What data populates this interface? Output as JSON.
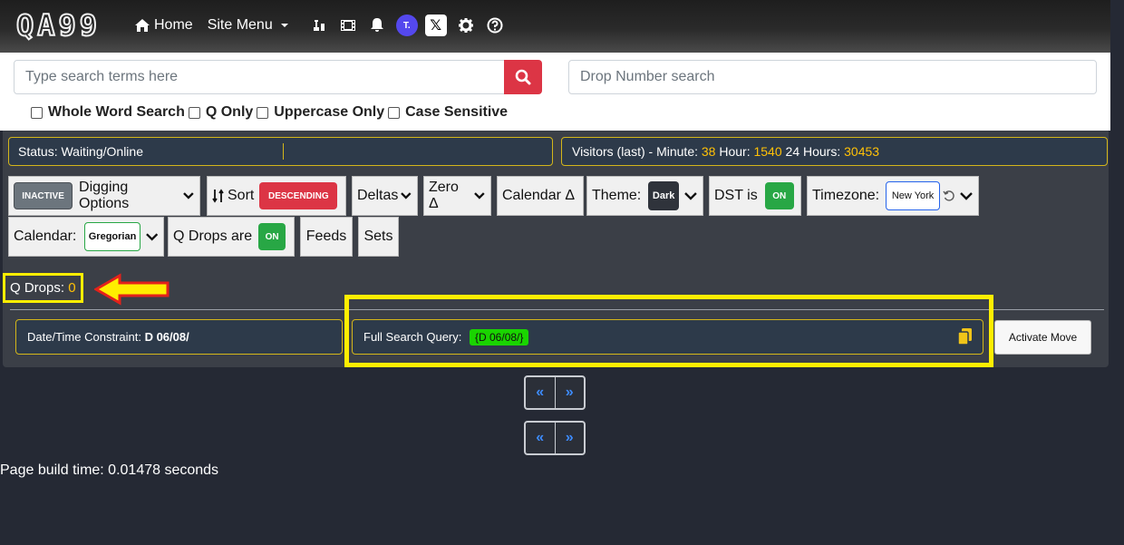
{
  "nav": {
    "logo_chars": [
      "Q",
      "A",
      "9",
      "9"
    ],
    "home_label": "Home",
    "site_menu_label": "Site Menu",
    "truth_label": "T."
  },
  "search": {
    "placeholder": "Type search terms here",
    "drop_placeholder": "Drop Number search",
    "options": [
      "Whole Word Search",
      "Q Only",
      "Uppercase Only",
      "Case Sensitive"
    ]
  },
  "status": {
    "text": "Status: Waiting/Online"
  },
  "visitors": {
    "prefix": "Visitors (last) - Minute: ",
    "minute": "38",
    "hour_label": " Hour: ",
    "hour": "1540",
    "day_label": " 24 Hours: ",
    "day": "30453"
  },
  "toolbar": {
    "inactive": "INACTIVE",
    "digging": "Digging Options",
    "sort": "Sort",
    "descending": "DESCENDING",
    "deltas": "Deltas",
    "zero_delta": "Zero Δ",
    "calendar_delta": "Calendar Δ",
    "theme_label": "Theme:",
    "theme_value": "Dark",
    "dst_label": "DST is",
    "dst_value": "ON",
    "timezone_label": "Timezone:",
    "timezone_value": "New York",
    "calendar_label": "Calendar:",
    "calendar_value": "Gregorian",
    "qdrops_are": "Q Drops are",
    "qdrops_value": "ON",
    "feeds": "Feeds",
    "sets": "Sets"
  },
  "qdrops": {
    "label": "Q Drops: ",
    "count": "0"
  },
  "constraints": {
    "dt_label": "Date/Time Constraint: ",
    "dt_value": "D 06/08/",
    "fsq_label": "Full Search Query: ",
    "fsq_value": "{D 06/08/}",
    "activate": "Activate Move"
  },
  "pager": {
    "prev": "«",
    "next": "»"
  },
  "footer": {
    "build_time": "Page build time: 0.01478 seconds"
  },
  "colors": {
    "accent_yellow": "#ffee00",
    "danger": "#dc3545",
    "success": "#28a745",
    "link": "#3d8bfd"
  }
}
